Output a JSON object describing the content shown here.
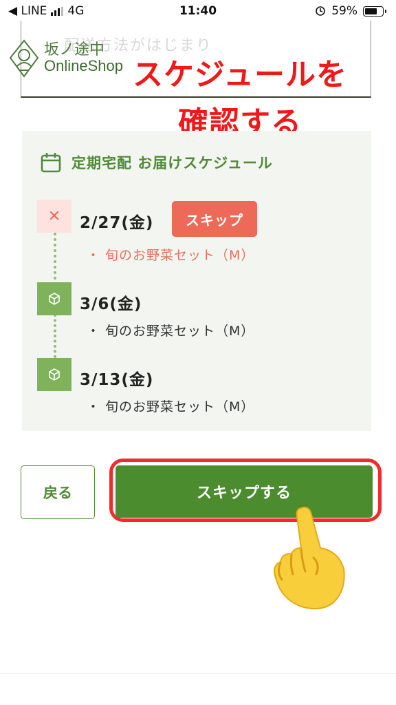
{
  "status_bar": {
    "back_label": "◀ LINE",
    "network": "4G",
    "time": "11:40",
    "battery_percent": "59%",
    "battery_level": 0.59
  },
  "header": {
    "faded_text": "配送方法がはじまり",
    "logo_title": "坂ノ途中",
    "logo_subtitle": "OnlineShop"
  },
  "annotation": {
    "line1": "スケジュールを",
    "line2": "確認する",
    "color": "#f01818"
  },
  "schedule": {
    "title": "定期宅配 お届けスケジュール",
    "entries": [
      {
        "date": "2/27(金)",
        "item": "・ 旬のお野菜セット（M）",
        "status": "skipped",
        "badge": "スキップ"
      },
      {
        "date": "3/6(金)",
        "item": "・ 旬のお野菜セット（M）",
        "status": "scheduled"
      },
      {
        "date": "3/13(金)",
        "item": "・ 旬のお野菜セット（M）",
        "status": "scheduled"
      }
    ]
  },
  "actions": {
    "back_label": "戻る",
    "skip_label": "スキップする"
  },
  "colors": {
    "brand_green": "#4b8c2e",
    "skip_red": "#ee6a58",
    "panel_bg": "#f3f5f0",
    "highlight_red": "#f42a2a"
  },
  "icons": [
    "calendar-icon",
    "close-icon",
    "package-icon",
    "pointing-hand-icon",
    "alarm-lock-icon",
    "battery-icon",
    "signal-icon"
  ]
}
